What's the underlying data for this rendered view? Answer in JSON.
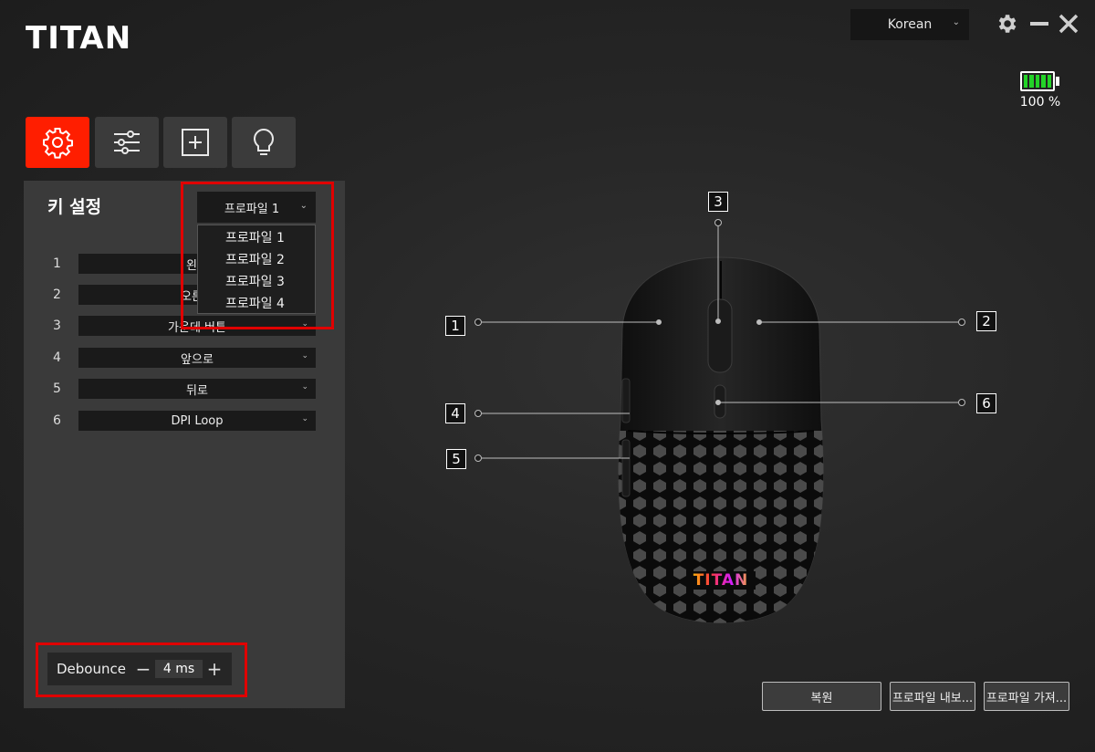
{
  "app": {
    "logo_text": "TITAN"
  },
  "language": {
    "selected": "Korean"
  },
  "battery": {
    "percent_label": "100 %",
    "level": 1.0,
    "color": "#23d328"
  },
  "tabs": [
    {
      "icon": "gear-icon",
      "active": true
    },
    {
      "icon": "sliders-icon",
      "active": false
    },
    {
      "icon": "macro-icon",
      "active": false
    },
    {
      "icon": "lightbulb-icon",
      "active": false
    }
  ],
  "panel": {
    "title": "키 설정",
    "profile_selected": "프로파일 1",
    "profile_options": [
      "프로파일 1",
      "프로파일 2",
      "프로파일 3",
      "프로파일 4"
    ],
    "keys": [
      {
        "num": "1",
        "value": "왼쪽"
      },
      {
        "num": "2",
        "value": "오른쪽"
      },
      {
        "num": "3",
        "value": "가운데 버튼"
      },
      {
        "num": "4",
        "value": "앞으로"
      },
      {
        "num": "5",
        "value": "뒤로"
      },
      {
        "num": "6",
        "value": "DPI Loop"
      }
    ],
    "debounce": {
      "label": "Debounce",
      "value": "4 ms"
    }
  },
  "mouse": {
    "callouts": [
      "1",
      "2",
      "3",
      "4",
      "5",
      "6"
    ],
    "logo_text": "TITAN"
  },
  "buttons": {
    "restore": "복원",
    "export_profile": "프로파일 내보...",
    "import_profile": "프로파일 가져..."
  },
  "colors": {
    "accent": "#ff1e00",
    "highlight": "#e00000"
  }
}
